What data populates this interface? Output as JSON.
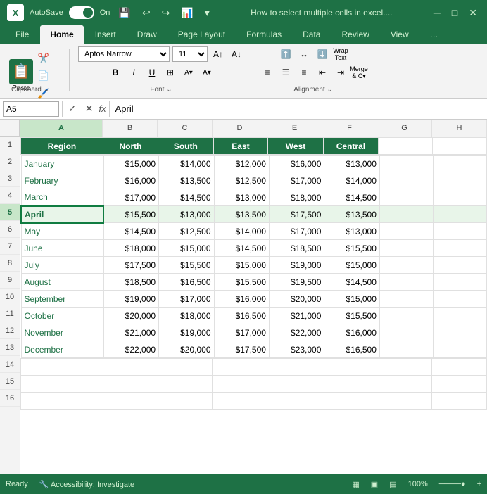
{
  "titleBar": {
    "appName": "X",
    "autosave": "AutoSave",
    "toggleState": "On",
    "title": "How to select multiple cells in excel....",
    "icons": [
      "undo",
      "redo",
      "customize"
    ]
  },
  "ribbon": {
    "tabs": [
      "File",
      "Home",
      "Insert",
      "Draw",
      "Page Layout",
      "Formulas",
      "Data",
      "Review",
      "View",
      "..."
    ],
    "activeTab": "Home",
    "font": {
      "name": "Aptos Narrow",
      "size": "11"
    },
    "groups": [
      "Clipboard",
      "Font",
      "Alignment"
    ]
  },
  "formulaBar": {
    "cellRef": "A5",
    "formula": "April"
  },
  "columns": {
    "headers": [
      "A",
      "B",
      "C",
      "D",
      "E",
      "F",
      "G",
      "H"
    ],
    "widths": [
      120,
      80,
      80,
      80,
      80,
      80,
      80,
      80
    ]
  },
  "rows": [
    "1",
    "2",
    "3",
    "4",
    "5",
    "6",
    "7",
    "8",
    "9",
    "10",
    "11",
    "12",
    "13",
    "14",
    "15",
    "16"
  ],
  "tableHeaders": {
    "region": "Region",
    "north": "North",
    "south": "South",
    "east": "East",
    "west": "West",
    "central": "Central"
  },
  "tableData": [
    {
      "month": "January",
      "north": "$15,000",
      "south": "$14,000",
      "east": "$12,000",
      "west": "$16,000",
      "central": "$13,000"
    },
    {
      "month": "February",
      "north": "$16,000",
      "south": "$13,500",
      "east": "$12,500",
      "west": "$17,000",
      "central": "$14,000"
    },
    {
      "month": "March",
      "north": "$17,000",
      "south": "$14,500",
      "east": "$13,000",
      "west": "$18,000",
      "central": "$14,500"
    },
    {
      "month": "April",
      "north": "$15,500",
      "south": "$13,000",
      "east": "$13,500",
      "west": "$17,500",
      "central": "$13,500"
    },
    {
      "month": "May",
      "north": "$14,500",
      "south": "$12,500",
      "east": "$14,000",
      "west": "$17,000",
      "central": "$13,000"
    },
    {
      "month": "June",
      "north": "$18,000",
      "south": "$15,000",
      "east": "$14,500",
      "west": "$18,500",
      "central": "$15,500"
    },
    {
      "month": "July",
      "north": "$17,500",
      "south": "$15,500",
      "east": "$15,000",
      "west": "$19,000",
      "central": "$15,000"
    },
    {
      "month": "August",
      "north": "$18,500",
      "south": "$16,500",
      "east": "$15,500",
      "west": "$19,500",
      "central": "$14,500"
    },
    {
      "month": "September",
      "north": "$19,000",
      "south": "$17,000",
      "east": "$16,000",
      "west": "$20,000",
      "central": "$15,000"
    },
    {
      "month": "October",
      "north": "$20,000",
      "south": "$18,000",
      "east": "$16,500",
      "west": "$21,000",
      "central": "$15,500"
    },
    {
      "month": "November",
      "north": "$21,000",
      "south": "$19,000",
      "east": "$17,000",
      "west": "$22,000",
      "central": "$16,000"
    },
    {
      "month": "December",
      "north": "$22,000",
      "south": "$20,000",
      "east": "$17,500",
      "west": "$23,000",
      "central": "$16,500"
    }
  ],
  "statusBar": {
    "items": [
      "Ready",
      "Accessibility: Investigate"
    ]
  }
}
